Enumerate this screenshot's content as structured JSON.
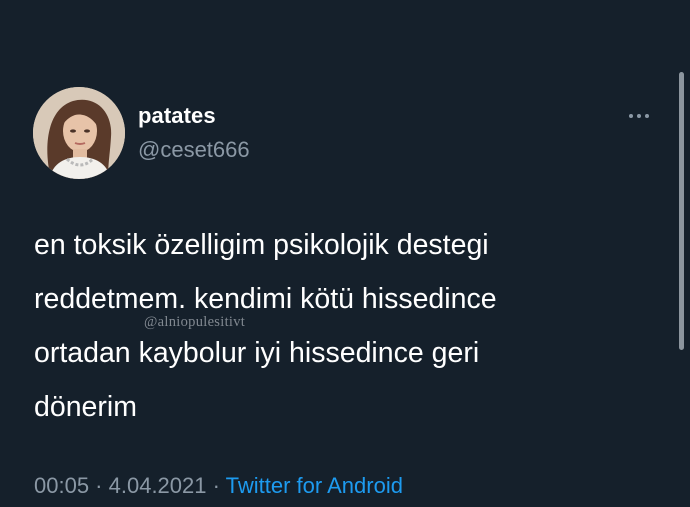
{
  "tweet": {
    "author": {
      "display_name": "patates",
      "handle": "@ceset666",
      "avatar_icon": "profile-photo"
    },
    "more_icon": "more-options-icon",
    "text_lines": [
      "en toksik özelligim psikolojik destegi",
      "reddetmem. kendimi kötü hissedince",
      "ortadan kaybolur iyi hissedince geri",
      "dönerim"
    ],
    "watermark": "@alniopulesitivt",
    "meta": {
      "time": "00:05",
      "separator": " · ",
      "date": "4.04.2021",
      "source": "Twitter for Android"
    }
  },
  "colors": {
    "background": "#15202b",
    "text": "#ffffff",
    "secondary": "#8b98a5",
    "link": "#1d9bf0"
  }
}
